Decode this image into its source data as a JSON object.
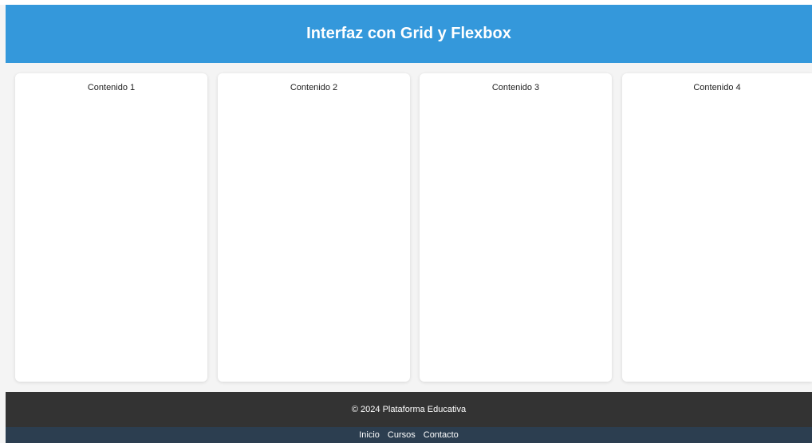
{
  "header": {
    "title": "Interfaz con Grid y Flexbox"
  },
  "content": {
    "cards": [
      {
        "label": "Contenido 1"
      },
      {
        "label": "Contenido 2"
      },
      {
        "label": "Contenido 3"
      },
      {
        "label": "Contenido 4"
      }
    ]
  },
  "footer": {
    "text": "© 2024 Plataforma Educativa"
  },
  "nav": {
    "links": [
      {
        "label": "Inicio"
      },
      {
        "label": "Cursos"
      },
      {
        "label": "Contacto"
      }
    ]
  },
  "colors": {
    "header_bg": "#3498db",
    "footer_bg": "#333333",
    "nav_bg": "#2c3e50",
    "page_bg": "#f4f4f4"
  }
}
